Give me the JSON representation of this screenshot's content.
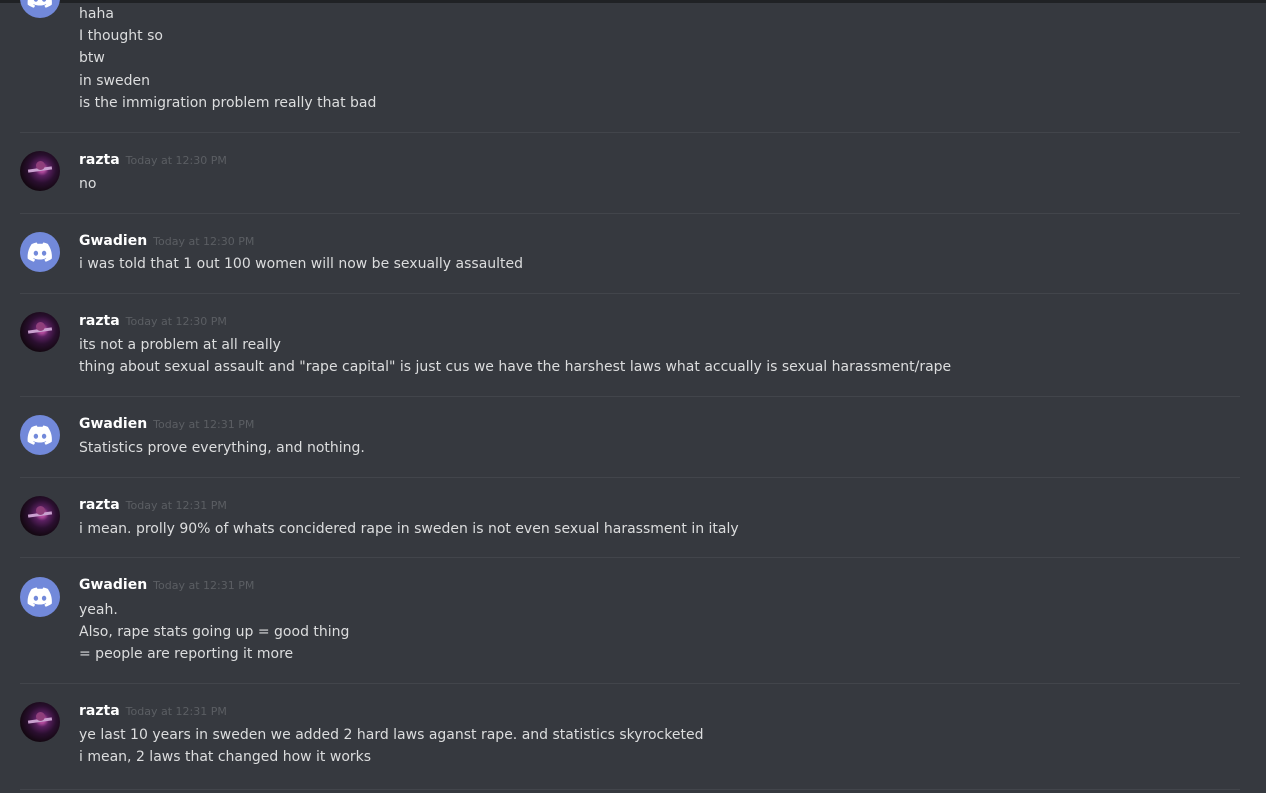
{
  "messages": [
    {
      "author": "",
      "avatar": "discord-icon",
      "timestamp": "",
      "lines": [
        "haha",
        "I thought so",
        "btw",
        "in sweden",
        "is the immigration problem really that bad"
      ]
    },
    {
      "author": "razta",
      "avatar": "user-photo",
      "timestamp": "Today at 12:30 PM",
      "lines": [
        "no"
      ]
    },
    {
      "author": "Gwadien",
      "avatar": "discord-icon",
      "timestamp": "Today at 12:30 PM",
      "lines": [
        "i was told that 1 out 100 women will now be sexually assaulted"
      ]
    },
    {
      "author": "razta",
      "avatar": "user-photo",
      "timestamp": "Today at 12:30 PM",
      "lines": [
        "its not a problem at all really",
        "thing about sexual assault and \"rape capital\" is just cus we have the harshest laws what accually is sexual harassment/rape"
      ]
    },
    {
      "author": "Gwadien",
      "avatar": "discord-icon",
      "timestamp": "Today at 12:31 PM",
      "lines": [
        "Statistics prove everything, and nothing."
      ]
    },
    {
      "author": "razta",
      "avatar": "user-photo",
      "timestamp": "Today at 12:31 PM",
      "lines": [
        "i mean. prolly 90% of whats concidered rape in sweden is not even sexual harassment in italy"
      ]
    },
    {
      "author": "Gwadien",
      "avatar": "discord-icon",
      "timestamp": "Today at 12:31 PM",
      "lines": [
        "yeah.",
        "Also, rape stats going up = good thing",
        "= people are reporting it more"
      ]
    },
    {
      "author": "razta",
      "avatar": "user-photo",
      "timestamp": "Today at 12:31 PM",
      "lines": [
        "ye last 10 years in sweden we added 2 hard laws aganst rape. and statistics skyrocketed",
        "i mean, 2 laws that changed how it works"
      ]
    }
  ],
  "colors": {
    "background": "#36393f",
    "username": "#ffffff",
    "timestamp": "#5b5e63",
    "message_text": "#dcddde",
    "discord_blurple": "#7289da"
  }
}
